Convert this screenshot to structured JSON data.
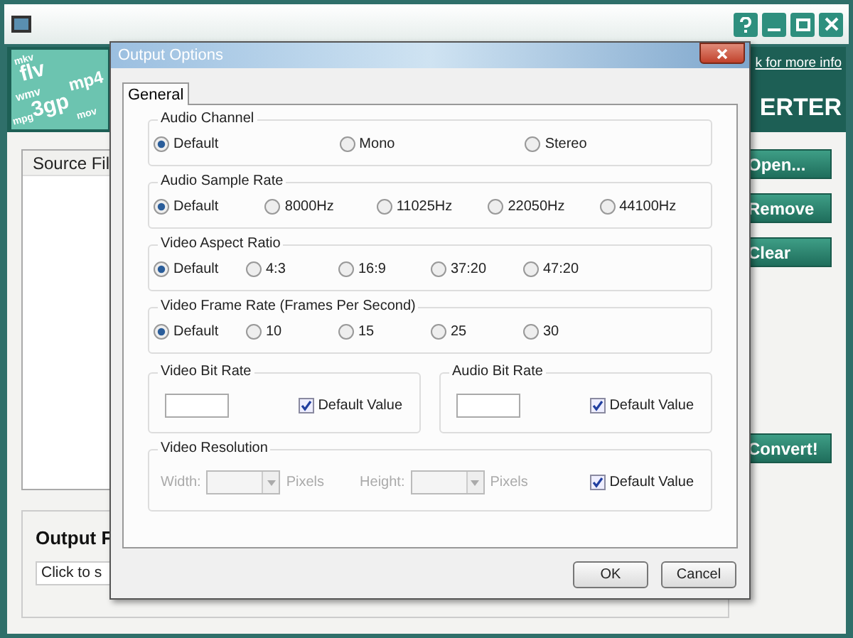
{
  "main_window": {
    "banner": {
      "logo_words": [
        "flv",
        "mp4",
        "3gp",
        "wmv",
        "mkv",
        "mpg",
        "mov"
      ],
      "info_link": "k for more info",
      "brand_text": "ERTER"
    },
    "source_list": {
      "column_header": "Source Fil"
    },
    "buttons": [
      "Open...",
      "Remove",
      "Clear",
      "Convert!"
    ],
    "output_panel": {
      "label": "Output F",
      "field_value": "Click to s"
    }
  },
  "dialog": {
    "title": "Output Options",
    "tabs": [
      {
        "label": "General",
        "selected": true
      }
    ],
    "radio_groups": [
      {
        "title": "Audio Channel",
        "options": [
          {
            "label": "Default",
            "selected": true
          },
          {
            "label": "Mono",
            "selected": false
          },
          {
            "label": "Stereo",
            "selected": false
          }
        ]
      },
      {
        "title": "Audio Sample Rate",
        "options": [
          {
            "label": "Default",
            "selected": true
          },
          {
            "label": "8000Hz",
            "selected": false
          },
          {
            "label": "11025Hz",
            "selected": false
          },
          {
            "label": "22050Hz",
            "selected": false
          },
          {
            "label": "44100Hz",
            "selected": false
          }
        ]
      },
      {
        "title": "Video Aspect Ratio",
        "options": [
          {
            "label": "Default",
            "selected": true
          },
          {
            "label": "4:3",
            "selected": false
          },
          {
            "label": "16:9",
            "selected": false
          },
          {
            "label": "37:20",
            "selected": false
          },
          {
            "label": "47:20",
            "selected": false
          }
        ]
      },
      {
        "title": "Video Frame Rate (Frames Per Second)",
        "options": [
          {
            "label": "Default",
            "selected": true
          },
          {
            "label": "10",
            "selected": false
          },
          {
            "label": "15",
            "selected": false
          },
          {
            "label": "25",
            "selected": false
          },
          {
            "label": "30",
            "selected": false
          }
        ]
      }
    ],
    "bit_rates": [
      {
        "title": "Video Bit Rate",
        "checkbox": {
          "label": "Default Value",
          "checked": true
        }
      },
      {
        "title": "Audio Bit Rate",
        "checkbox": {
          "label": "Default Value",
          "checked": true
        }
      }
    ],
    "resolution": {
      "title": "Video Resolution",
      "disabled": true,
      "width_label": "Width:",
      "width_unit": "Pixels",
      "height_label": "Height:",
      "height_unit": "Pixels",
      "checkbox": {
        "label": "Default Value",
        "checked": true
      }
    },
    "buttons": [
      "OK",
      "Cancel"
    ]
  }
}
